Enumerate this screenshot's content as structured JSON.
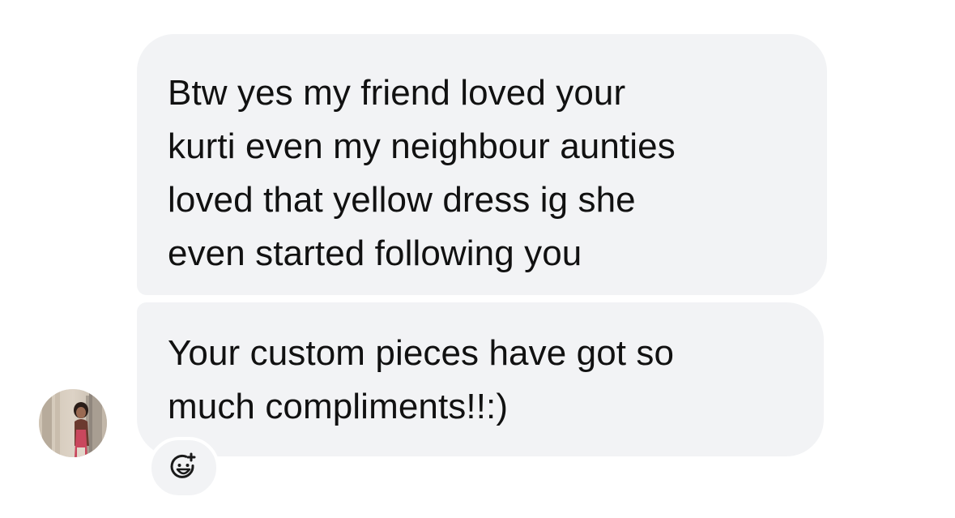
{
  "messages": [
    {
      "sender": "received",
      "text": "Btw yes my friend loved your\nkurti even my neighbour aunties\nloved that yellow dress ig she\neven started following you"
    },
    {
      "sender": "received",
      "text": "Your custom pieces have got so\nmuch compliments!!:)"
    }
  ],
  "reaction_button": {
    "icon": "add-reaction-icon"
  },
  "avatar": {
    "icon": "avatar-photo"
  },
  "colors": {
    "bubble_bg": "#f2f3f5",
    "text": "#111111",
    "background": "#ffffff"
  }
}
